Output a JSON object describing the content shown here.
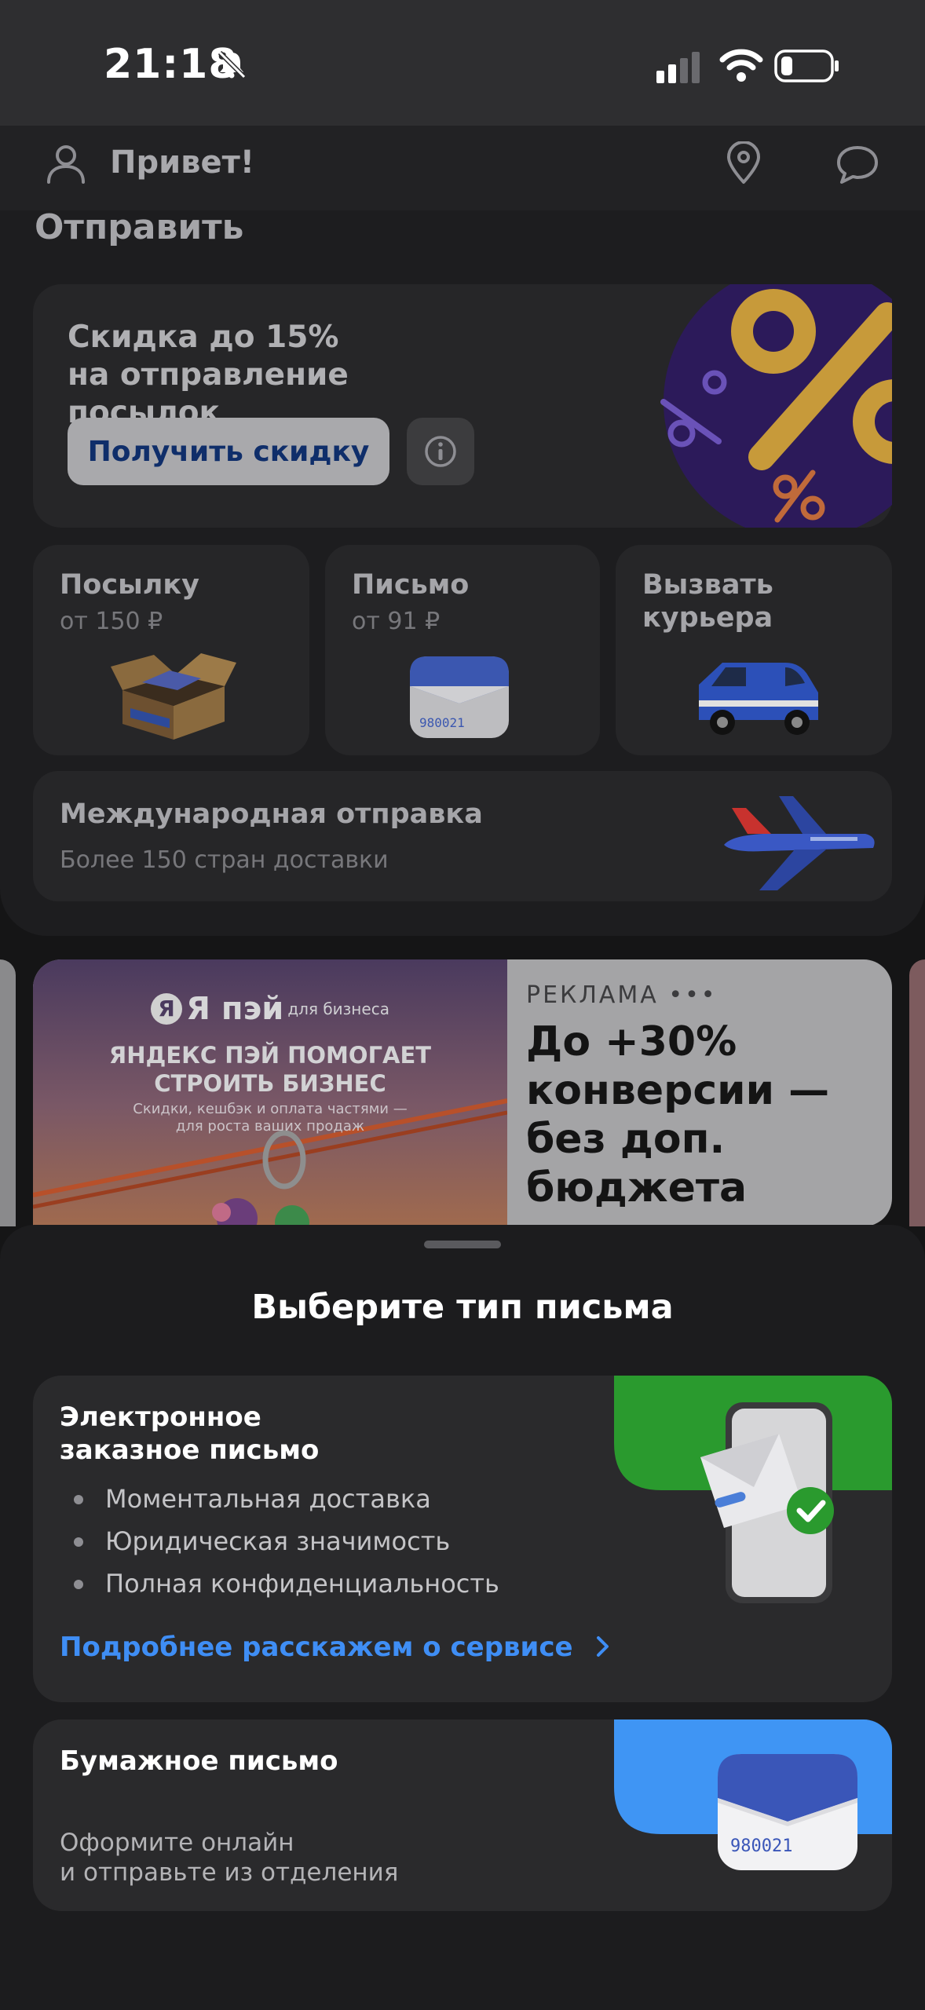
{
  "status": {
    "time": "21:18"
  },
  "header": {
    "greeting": "Привет!"
  },
  "send": {
    "title": "Отправить",
    "promo": {
      "line1": "Скидка до 15%",
      "line2": "на отправление посылок",
      "button": "Получить скидку"
    },
    "tiles": [
      {
        "title": "Посылку",
        "price": "от 150 ₽"
      },
      {
        "title": "Письмо",
        "price": "от 91 ₽"
      },
      {
        "title_line1": "Вызвать",
        "title_line2": "курьера"
      }
    ],
    "international": {
      "title": "Международная отправка",
      "subtitle": "Более 150 стран доставки"
    }
  },
  "ad": {
    "label": "РЕКЛАМА",
    "dots": "•••",
    "headline": [
      "До +30%",
      "конверсии —",
      "без доп.",
      "бюджета"
    ],
    "image": {
      "brand": "Я пэй",
      "brand_sub": "для бизнеса",
      "line1": "ЯНДЕКС ПЭЙ ПОМОГАЕТ",
      "line2": "СТРОИТЬ БИЗНЕС",
      "small1": "Скидки, кешбэк и оплата частями —",
      "small2": "для роста ваших продаж"
    }
  },
  "sheet": {
    "title": "Выберите тип письма",
    "electronic": {
      "title_line1": "Электронное",
      "title_line2": "заказное письмо",
      "bullets": [
        "Моментальная доставка",
        "Юридическая значимость",
        "Полная конфиденциальность"
      ],
      "link": "Подробнее расскажем о сервисе",
      "accent": "#2a9a2e"
    },
    "paper": {
      "title": "Бумажное письмо",
      "desc_line1": "Оформите онлайн",
      "desc_line2": "и отправьте из отделения",
      "accent": "#3f95f4"
    },
    "envelope_code": "980021"
  }
}
